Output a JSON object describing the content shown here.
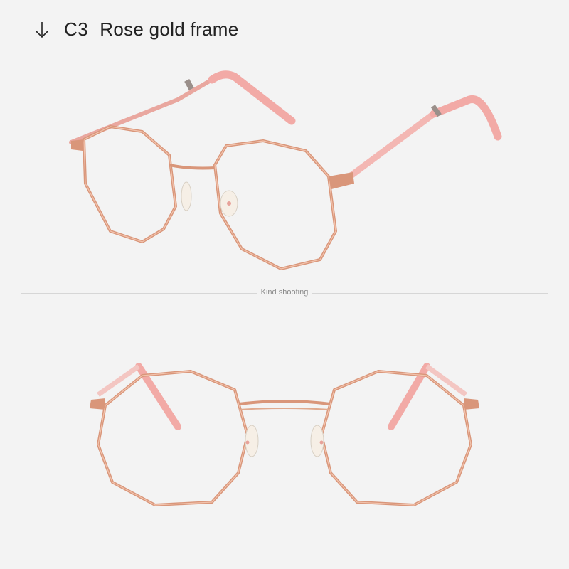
{
  "header": {
    "icon": "arrow-down-icon",
    "code": "C3",
    "title": "Rose gold frame"
  },
  "divider": {
    "label": "Kind shooting"
  },
  "colors": {
    "frame": "#d9967a",
    "frame_highlight": "#f2c3ad",
    "temple_pink": "#f2aaa6",
    "background": "#f3f3f3"
  },
  "images": {
    "side_view": "rose-gold-glasses-angled-view",
    "front_view": "rose-gold-glasses-front-view"
  }
}
